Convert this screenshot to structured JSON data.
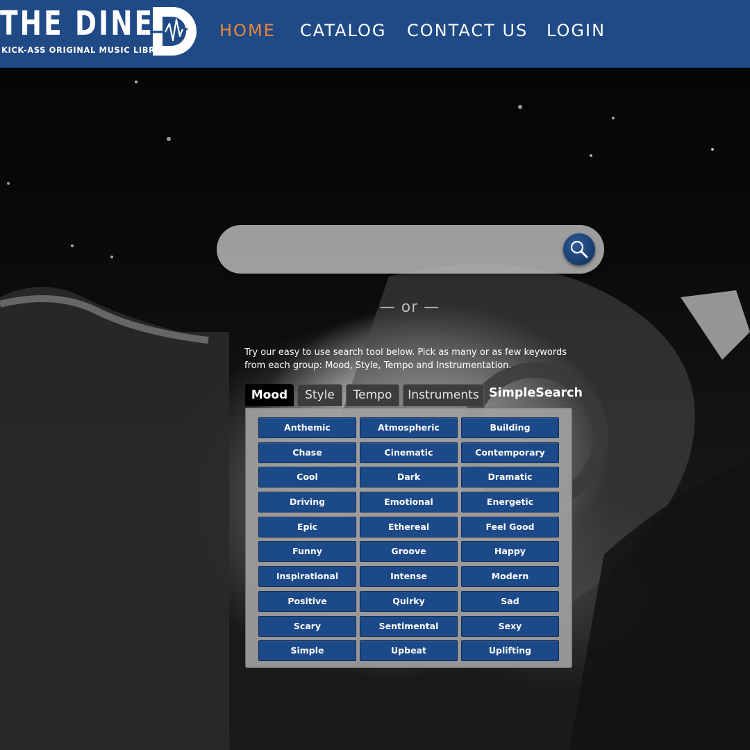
{
  "brand": {
    "title": "THE DINER",
    "tagline": "KICK-ASS ORIGINAL MUSIC LIBRARY",
    "mark_letter": "D",
    "accent_color": "#e8873a",
    "header_color": "#1f4a86",
    "button_color": "#1c4987"
  },
  "nav": {
    "home": "HOME",
    "catalog": "CATALOG",
    "contact": "CONTACT US",
    "login": "LOGIN"
  },
  "search": {
    "value": "",
    "placeholder": "",
    "button_icon": "magnifier-icon"
  },
  "divider_text": "— or —",
  "intro_text": "Try our easy to use search tool below. Pick as many or as few keywords from each group: Mood, Style, Tempo and Instrumentation.",
  "tabs": {
    "mood": "Mood",
    "style": "Style",
    "tempo": "Tempo",
    "instruments": "Instruments",
    "simple_search": "SimpleSearch",
    "active": "Mood"
  },
  "moods": [
    "Anthemic",
    "Atmospheric",
    "Building",
    "Chase",
    "Cinematic",
    "Contemporary",
    "Cool",
    "Dark",
    "Dramatic",
    "Driving",
    "Emotional",
    "Energetic",
    "Epic",
    "Ethereal",
    "Feel Good",
    "Funny",
    "Groove",
    "Happy",
    "Inspirational",
    "Intense",
    "Modern",
    "Positive",
    "Quirky",
    "Sad",
    "Scary",
    "Sentimental",
    "Sexy",
    "Simple",
    "Upbeat",
    "Uplifting"
  ]
}
